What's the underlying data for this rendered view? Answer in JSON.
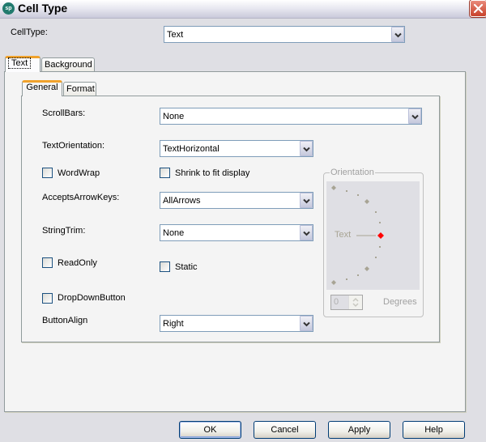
{
  "window": {
    "title": "Cell Type",
    "app_icon_text": "sp",
    "close_icon": "close-icon"
  },
  "celltype": {
    "label": "CellType:",
    "value": "Text"
  },
  "outer_tabs": [
    {
      "label": "Text",
      "active": true
    },
    {
      "label": "Background",
      "active": false
    }
  ],
  "inner_tabs": [
    {
      "label": "General",
      "active": true
    },
    {
      "label": "Format",
      "active": false
    }
  ],
  "general": {
    "scrollbars": {
      "label": "ScrollBars:",
      "value": "None"
    },
    "text_orientation": {
      "label": "TextOrientation:",
      "value": "TextHorizontal"
    },
    "wordwrap": {
      "label": "WordWrap",
      "checked": false
    },
    "shrink_to_fit": {
      "label": "Shrink to fit display",
      "checked": false
    },
    "accepts_arrow_keys": {
      "label": "AcceptsArrowKeys:",
      "value": "AllArrows"
    },
    "string_trim": {
      "label": "StringTrim:",
      "value": "None"
    },
    "read_only": {
      "label": "ReadOnly",
      "checked": false
    },
    "static": {
      "label": "Static",
      "checked": false
    },
    "dropdown_button": {
      "label": "DropDownButton",
      "checked": false
    },
    "button_align": {
      "label": "ButtonAlign",
      "value": "Right"
    }
  },
  "orientation": {
    "legend": "Orientation",
    "sample_text": "Text",
    "degrees_value": "0",
    "degrees_label": "Degrees",
    "selected_color": "#ff0000",
    "marker_color": "#a8a494"
  },
  "buttons": {
    "ok": "OK",
    "cancel": "Cancel",
    "apply": "Apply",
    "help": "Help"
  }
}
